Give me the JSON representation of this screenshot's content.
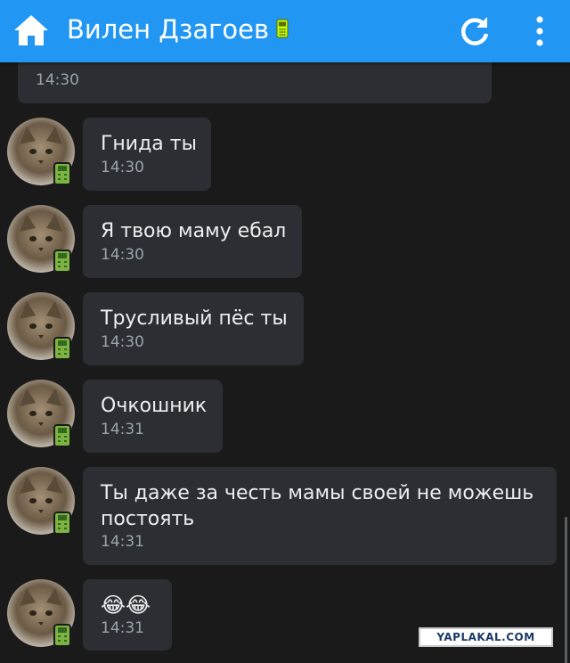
{
  "header": {
    "title": "Вилен Дзагоев",
    "home_icon": "home-icon",
    "status_icon": "mobile-phone-icon",
    "refresh_icon": "refresh-icon",
    "menu_icon": "more-vertical-icon",
    "accent": "#2196f3"
  },
  "messages": [
    {
      "text": "",
      "time": "14:30"
    },
    {
      "text": "Гнида ты",
      "time": "14:30"
    },
    {
      "text": "Я твою маму ебал",
      "time": "14:30"
    },
    {
      "text": "Трусливый пёс ты",
      "time": "14:30"
    },
    {
      "text": "Очкошник",
      "time": "14:31"
    },
    {
      "text": "Ты даже за честь мамы своей не можешь\nпостоять",
      "time": "14:31"
    },
    {
      "text": "😂😂",
      "time": "14:31"
    }
  ],
  "watermark": "YAPLAKAL.COM",
  "colors": {
    "background": "#1a1a1a",
    "bubble": "#2c2e33",
    "time": "#9aa3ab",
    "online_badge": "#7cb342"
  }
}
